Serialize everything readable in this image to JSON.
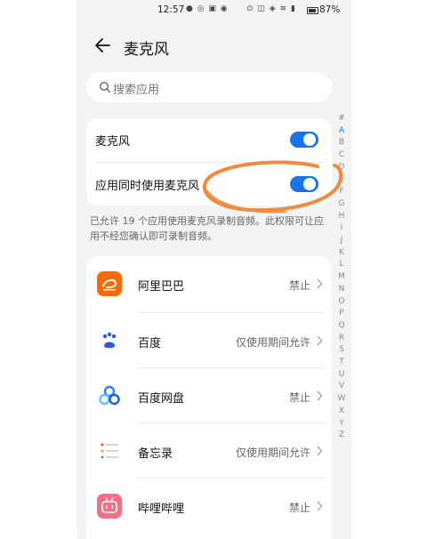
{
  "status_bar": {
    "time": "12:57",
    "left_icons": "● ◎ ▣ ◉",
    "right_icons": "⊙ ◫ ◈ ≋ ▮",
    "battery": "87%",
    "battery_level": 0.87
  },
  "header": {
    "title": "麦克风"
  },
  "search": {
    "placeholder": "搜索应用"
  },
  "toggles": [
    {
      "label": "麦克风",
      "on": true
    },
    {
      "label": "应用同时使用麦克风",
      "on": true
    }
  ],
  "notice": "已允许 19 个应用使用麦克风录制音频。此权限可让应用不经您确认即可录制音频。",
  "index_letters": [
    "#",
    "A",
    "B",
    "C",
    "D",
    "E",
    "F",
    "G",
    "H",
    "I",
    "J",
    "K",
    "L",
    "M",
    "N",
    "O",
    "P",
    "Q",
    "R",
    "S",
    "T",
    "U",
    "V",
    "W",
    "X",
    "Y",
    "Z"
  ],
  "apps": [
    {
      "name": "阿里巴巴",
      "status": "禁止",
      "icon": "alibaba-icon"
    },
    {
      "name": "百度",
      "status": "仅使用期间允许",
      "icon": "baidu-icon"
    },
    {
      "name": "百度网盘",
      "status": "禁止",
      "icon": "baidu-netdisk-icon"
    },
    {
      "name": "备忘录",
      "status": "仅使用期间允许",
      "icon": "memo-icon"
    },
    {
      "name": "哔哩哔哩",
      "status": "禁止",
      "icon": "bilibili-icon"
    }
  ],
  "colors": {
    "accent": "#1a73e8",
    "annotation": "#f08a3c"
  }
}
